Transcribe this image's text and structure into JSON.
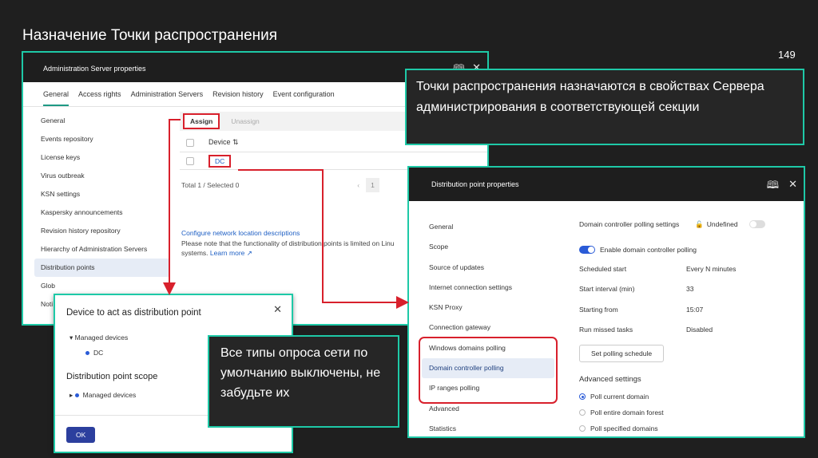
{
  "slide": {
    "title": "Назначение Точки распространения",
    "page_number": "149"
  },
  "admin_window": {
    "title": "Administration Server properties",
    "tabs": [
      "General",
      "Access rights",
      "Administration Servers",
      "Revision history",
      "Event configuration"
    ],
    "sidebar": [
      "General",
      "Events repository",
      "License keys",
      "Virus outbreak",
      "KSN settings",
      "Kaspersky announcements",
      "Revision history repository",
      "Hierarchy of Administration Servers",
      "Distribution points",
      "Glob",
      "Noti"
    ],
    "selected_sidebar": "Distribution points",
    "assign_label": "Assign",
    "unassign_label": "Unassign",
    "column_device": "Device ⇅",
    "device_row": "DC",
    "total_label": "Total 1 / Selected 0",
    "page": "1",
    "config_link": "Configure network location descriptions",
    "note": "Please note that the functionality of distribution points is limited on Linu",
    "note2": "systems.",
    "learn_more": "Learn more ↗"
  },
  "callout_top": "Точки распространения назначаются в свойствах Сервера администрирования в соответствующей секции",
  "device_dialog": {
    "title": "Device to act as distribution point",
    "managed_devices": "Managed devices",
    "dc": "DC",
    "scope_title": "Distribution point scope",
    "scope_managed_devices": "Managed devices",
    "ok_label": "OK"
  },
  "callout_bottom": "Все типы опроса сети по умолчанию выключены, не забудьте их",
  "dp_window": {
    "title": "Distribution point properties",
    "sidebar": [
      "General",
      "Scope",
      "Source of updates",
      "Internet connection settings",
      "KSN Proxy",
      "Connection gateway",
      "Windows domains polling",
      "Domain controller polling",
      "IP ranges polling",
      "Advanced",
      "Statistics"
    ],
    "selected_sidebar": "Domain controller polling",
    "settings_title": "Domain controller polling settings",
    "undefined_label": "Undefined",
    "enable_label": "Enable domain controller polling",
    "rows": [
      {
        "k": "Scheduled start",
        "v": "Every N minutes"
      },
      {
        "k": "Start interval (min)",
        "v": "33"
      },
      {
        "k": "Starting from",
        "v": "15:07"
      },
      {
        "k": "Run missed tasks",
        "v": "Disabled"
      }
    ],
    "schedule_button": "Set polling schedule",
    "advanced_title": "Advanced settings",
    "radios": [
      "Poll current domain",
      "Poll entire domain forest",
      "Poll specified domains"
    ],
    "selected_radio": "Poll current domain"
  },
  "colors": {
    "accent_frame": "#1ec9a7",
    "highlight_red": "#d8202c",
    "primary_blue": "#2a5bd7"
  }
}
